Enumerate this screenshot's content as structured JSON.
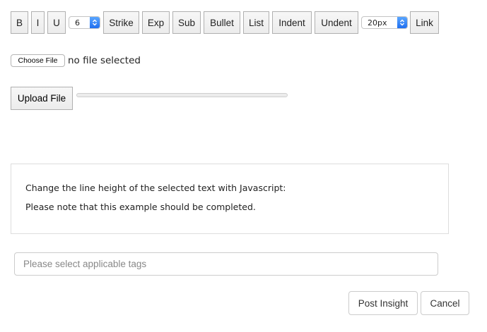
{
  "toolbar": {
    "bold": "B",
    "italic": "I",
    "underline": "U",
    "font_size_select": "6",
    "strike": "Strike",
    "exp": "Exp",
    "sub": "Sub",
    "bullet": "Bullet",
    "list": "List",
    "indent": "Indent",
    "undent": "Undent",
    "line_height_select": "20px",
    "link": "Link"
  },
  "file": {
    "choose_label": "Choose File",
    "status": "no file selected",
    "upload_label": "Upload File",
    "progress_percent": 0
  },
  "editor": {
    "lines": [
      "Change the line height of the selected text with Javascript:",
      "Please note that this example should be completed."
    ]
  },
  "tags": {
    "placeholder": "Please select applicable tags",
    "value": ""
  },
  "actions": {
    "post": "Post Insight",
    "cancel": "Cancel"
  },
  "colors": {
    "select_accent": "#1f6ff0"
  }
}
